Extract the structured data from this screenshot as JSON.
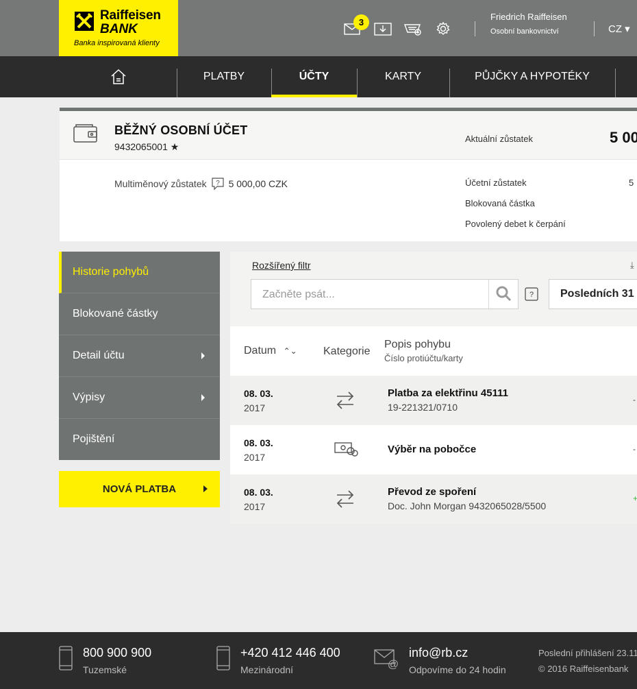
{
  "brand": {
    "line1": "Raiffeisen",
    "line2": "BANK",
    "tagline": "Banka inspirovaná klienty"
  },
  "header": {
    "messages_count": "3",
    "user_name": "Friedrich Raiffeisen",
    "user_type": "Osobní bankovnictví",
    "language": "CZ ▾"
  },
  "nav": {
    "items": [
      {
        "label": "PLATBY"
      },
      {
        "label": "ÚČTY"
      },
      {
        "label": "KARTY"
      },
      {
        "label": "PŮJČKY A HYPOTÉKY"
      }
    ]
  },
  "account": {
    "title": "BĚŽNÝ OSOBNÍ ÚČET",
    "number": "9432065001 ★",
    "current_balance_label": "Aktuální zůstatek",
    "current_balance_value": "5 00",
    "multicurrency_label": "Multiměnový zůstatek",
    "multicurrency_value": "5 000,00 CZK",
    "accounting_balance_label": "Účetní zůstatek",
    "accounting_balance_value": "5",
    "blocked_amount_label": "Blokovaná částka",
    "overdraft_label": "Povolený debet k čerpání"
  },
  "sidebar": {
    "items": [
      {
        "label": "Historie pohybů"
      },
      {
        "label": "Blokované částky"
      },
      {
        "label": "Detail účtu"
      },
      {
        "label": "Výpisy"
      },
      {
        "label": "Pojištění"
      }
    ],
    "new_payment": "NOVÁ PLATBA"
  },
  "filter": {
    "advanced": "Rozšířený filtr",
    "download": "⤓",
    "search_placeholder": "Začněte psát...",
    "period": "Posledních 31"
  },
  "table": {
    "col_date": "Datum",
    "col_category": "Kategorie",
    "col_desc": "Popis pohybu",
    "col_desc_sub": "Číslo protiúčtu/karty",
    "rows": [
      {
        "date": "08. 03.",
        "year": "2017",
        "title": "Platba za elektřinu 45111",
        "sub": "19-221321/0710",
        "amount": "-",
        "category_icon": "transfer-icon"
      },
      {
        "date": "08. 03.",
        "year": "2017",
        "title": "Výběr na pobočce",
        "sub": "",
        "amount": "-",
        "category_icon": "cash-icon"
      },
      {
        "date": "08. 03.",
        "year": "2017",
        "title": "Převod ze spoření",
        "sub": "Doc. John Morgan  9432065028/5500",
        "amount": "+",
        "category_icon": "transfer-icon"
      }
    ]
  },
  "footer": {
    "phone_domestic": "800 900 900",
    "phone_domestic_label": "Tuzemské",
    "phone_intl": "+420 412 446 400",
    "phone_intl_label": "Mezinárodní",
    "email": "info@rb.cz",
    "email_label": "Odpovíme do 24 hodin",
    "last_login": "Poslední přihlášení 23.11",
    "copyright": "© 2016 Raiffeisenbank"
  },
  "colors": {
    "accent": "#fff000",
    "topbar": "#757876",
    "nav": "#2c2c2c",
    "sidebar": "#6f7371",
    "positive": "#3bb43b"
  }
}
